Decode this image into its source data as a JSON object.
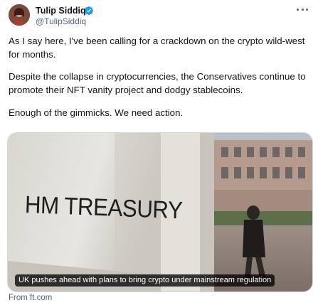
{
  "author": {
    "name": "Tulip Siddiq",
    "handle": "@TulipSiddiq",
    "verified": true,
    "avatar_icon": "profile-photo",
    "verified_icon": "verified-badge-icon",
    "verified_color": "#1d9bf0"
  },
  "tweet": {
    "paragraphs": [
      "As I say here, I've been calling for a crackdown on the crypto wild-west for months.",
      "Despite the collapse in cryptocurrencies, the Conservatives continue to promote their NFT vanity project and dodgy stablecoins.",
      "Enough of the gimmicks. We need action."
    ]
  },
  "card": {
    "sign_main": "HM TREASURY",
    "caption": "UK pushes ahead with plans to bring crypto under mainstream regulation",
    "source": "From ft.com"
  }
}
